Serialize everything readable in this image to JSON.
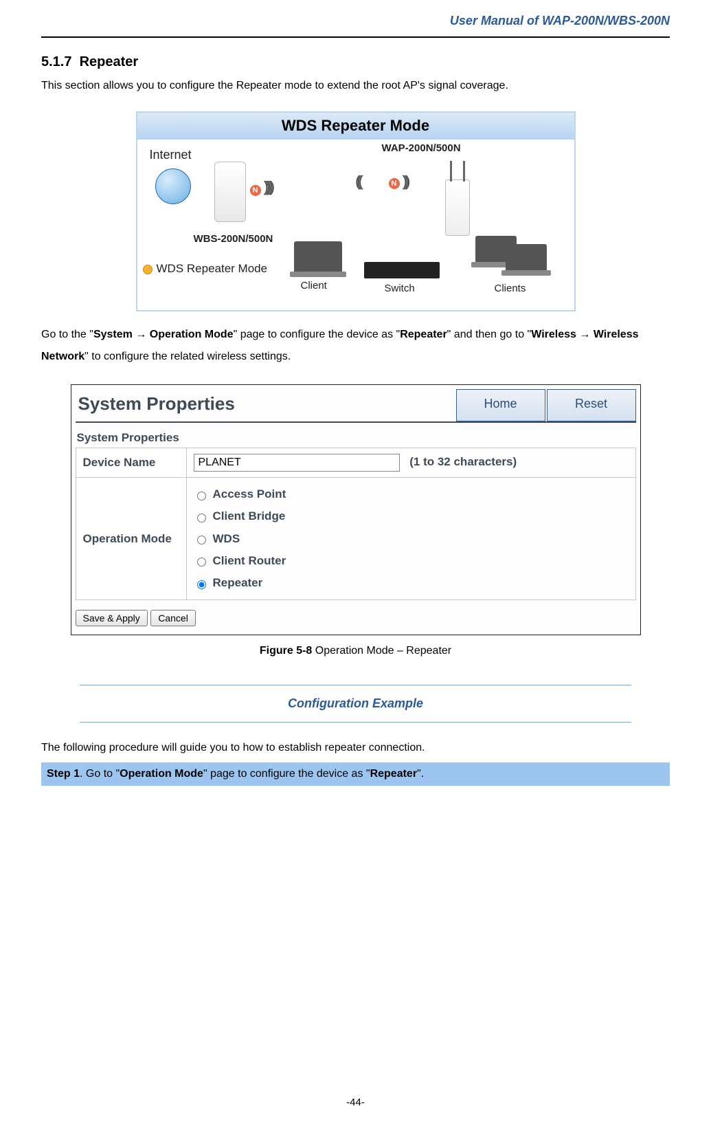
{
  "doc_header": "User Manual of WAP-200N/WBS-200N",
  "section": {
    "number": "5.1.7",
    "title": "Repeater"
  },
  "intro": "This section allows you to configure the Repeater mode to extend the root AP's signal coverage.",
  "diagram": {
    "title": "WDS Repeater Mode",
    "labels": {
      "internet": "Internet",
      "wbs": "WBS-200N/500N",
      "wap": "WAP-200N/500N",
      "mode": "WDS Repeater Mode",
      "client": "Client",
      "switch": "Switch",
      "clients": "Clients",
      "n": "N"
    }
  },
  "nav": {
    "pre": "Go to the \"",
    "p1": "System ",
    "arrow": "→",
    "p1b": " Operation Mode",
    "mid1": "\" page to configure the device as \"",
    "p2": "Repeater",
    "mid2": "\" and then go to \"",
    "p3a": "Wireless ",
    "p3b": "Wireless Network",
    "post": "\" to configure the related wireless settings."
  },
  "screenshot": {
    "page_title": "System Properties",
    "btn_home": "Home",
    "btn_reset": "Reset",
    "subtitle": "System Properties",
    "row_device_label": "Device Name",
    "device_value": "PLANET",
    "device_hint": "(1 to 32 characters)",
    "row_mode_label": "Operation Mode",
    "modes": {
      "ap": "Access Point",
      "cb": "Client Bridge",
      "wds": "WDS",
      "cr": "Client Router",
      "rp": "Repeater"
    },
    "btn_save": "Save & Apply",
    "btn_cancel": "Cancel"
  },
  "caption": {
    "fig": "Figure 5-8",
    "text": " Operation Mode – Repeater"
  },
  "conf_example": "Configuration Example",
  "following": "The following procedure will guide you to how to establish repeater connection.",
  "step1": {
    "label": "Step 1",
    "t1": ". Go to \"",
    "b1": "Operation Mode",
    "t2": "\" page to configure the device as \"",
    "b2": "Repeater",
    "t3": "\"."
  },
  "page_number": "-44-"
}
